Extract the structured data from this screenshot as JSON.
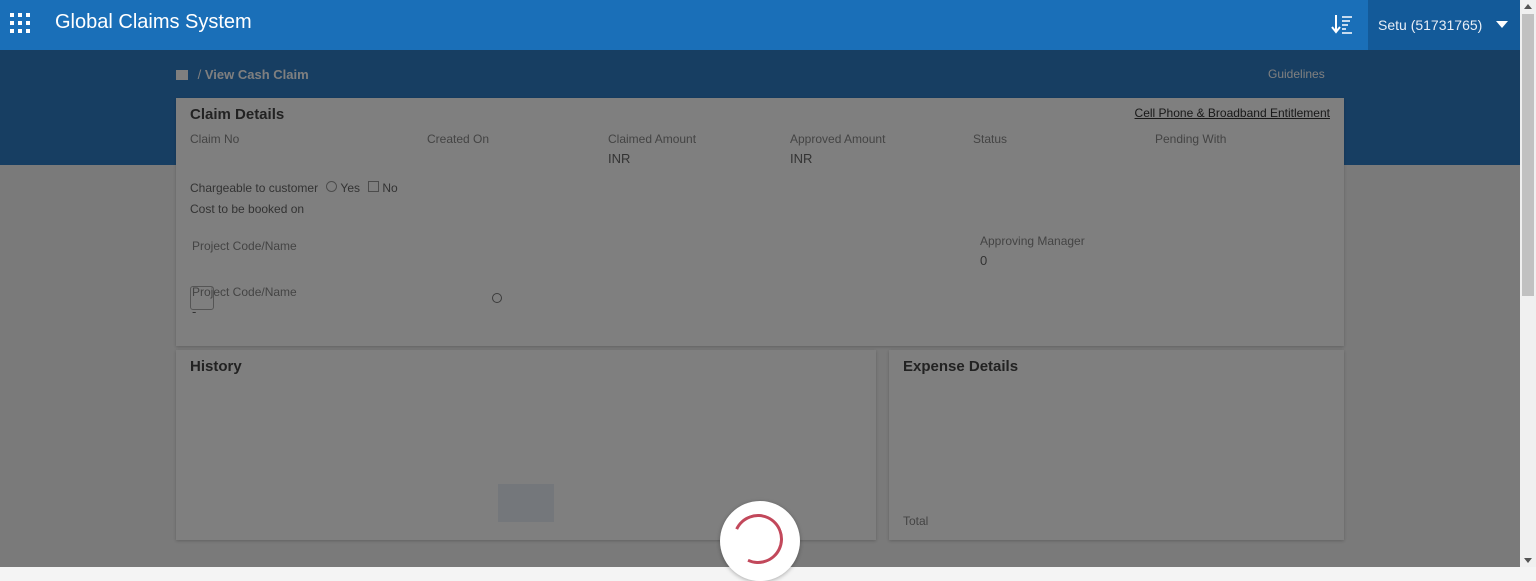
{
  "header": {
    "app_title": "Global Claims System",
    "user": "Setu (51731765)",
    "icons": [
      "apps-icon",
      "sort-icon",
      "caret-down-icon"
    ]
  },
  "breadcrumb": {
    "current": "View Cash Claim",
    "guide": "Guidelines"
  },
  "claim_details": {
    "title": "Claim Details",
    "entitlement_link": "Cell Phone & Broadband Entitlement",
    "fields": [
      {
        "label": "Claim No",
        "value": ""
      },
      {
        "label": "Created On",
        "value": ""
      },
      {
        "label": "Claimed Amount",
        "value": "INR"
      },
      {
        "label": "Approved Amount",
        "value": "INR"
      },
      {
        "label": "Status",
        "value": ""
      },
      {
        "label": "Pending With",
        "value": ""
      }
    ],
    "chargeable_label": "Chargeable to customer",
    "chargeable_yes": "Yes",
    "chargeable_no": "No",
    "cost_booked_label": "Cost to be booked on",
    "project_code_label": "Project Code/Name",
    "approving_manager_label": "Approving Manager",
    "approving_manager_value": "0",
    "project_code_label_2": "Project Code/Name",
    "project_code_value": "-"
  },
  "history": {
    "title": "History"
  },
  "expense_details": {
    "title": "Expense Details",
    "footer": "Total"
  },
  "colors": {
    "header": "#1a6fb8",
    "band": "#2f7cc5",
    "spinner": "#c2485b"
  }
}
